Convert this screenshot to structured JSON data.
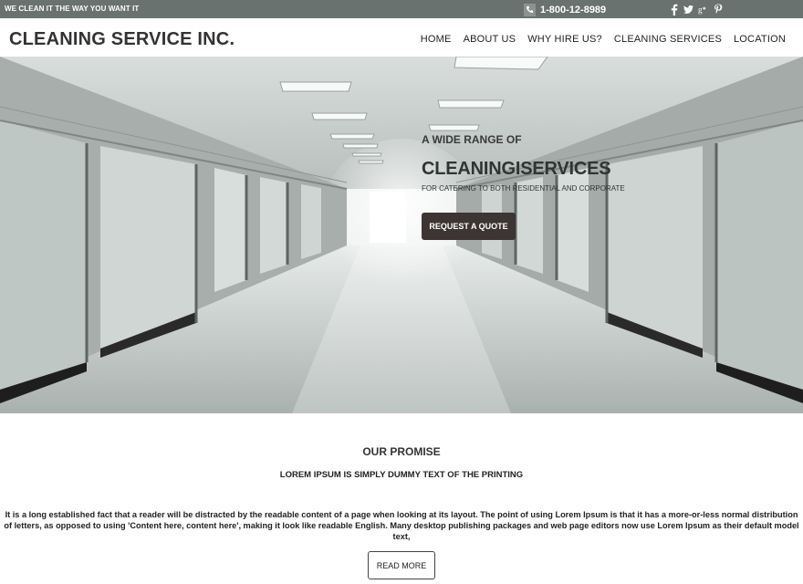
{
  "topbar": {
    "tagline": "WE CLEAN IT THE WAY YOU WANT IT",
    "phone": "1-800-12-8989",
    "phone_icon": "phone-icon",
    "social": [
      "facebook-icon",
      "twitter-icon",
      "google-plus-icon",
      "pinterest-icon"
    ]
  },
  "header": {
    "brand": "CLEANING SERVICE INC.",
    "nav": [
      "HOME",
      "ABOUT US",
      "WHY HIRE US?",
      "CLEANING SERVICES",
      "LOCATION"
    ]
  },
  "hero": {
    "pre": "A WIDE RANGE OF",
    "title": "CLEANINGISERVICES",
    "subtitle": "FOR CATERING TO BOTH RESIDENTIAL AND CORPORATE",
    "cta": "REQUEST A QUOTE"
  },
  "promise": {
    "title": "OUR PROMISE",
    "subtitle": "LOREM IPSUM IS SIMPLY DUMMY TEXT OF THE PRINTING",
    "body": "It is a long established fact that a reader will be distracted by the readable content of a page when looking at its layout. The point of using Lorem Ipsum is that it has a more-or-less normal distribution of letters, as opposed to using 'Content here, content here', making it look like readable English. Many desktop publishing packages and web page editors now use Lorem Ipsum as their default model text,",
    "button": "READ MORE"
  },
  "colors": {
    "topbar": "#6a726f",
    "button_dark": "#3d3533",
    "text": "#222222"
  }
}
